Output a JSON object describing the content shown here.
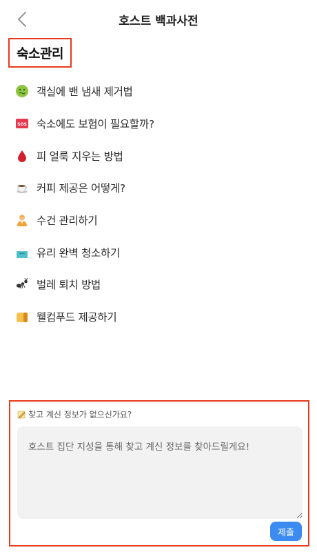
{
  "header": {
    "title": "호스트 백과사전",
    "back_icon": "chevron-left-icon"
  },
  "section": {
    "title": "숙소관리"
  },
  "topics": [
    {
      "label": "객실에 밴 냄새 제거법",
      "icon": "nauseated-face-icon"
    },
    {
      "label": "숙소에도 보험이 필요할까?",
      "icon": "sos-icon"
    },
    {
      "label": "피 얼룩 지우는 방법",
      "icon": "blood-drop-icon"
    },
    {
      "label": "커피 제공은 어떻게?",
      "icon": "coffee-icon"
    },
    {
      "label": "수건 관리하기",
      "icon": "person-icon"
    },
    {
      "label": "유리 완벽 청소하기",
      "icon": "tissue-box-icon"
    },
    {
      "label": "벌레 퇴치 방법",
      "icon": "ant-icon"
    },
    {
      "label": "웰컴푸드 제공하기",
      "icon": "bread-icon"
    }
  ],
  "request": {
    "label": "찾고 계신 정보가 없으신가요?",
    "icon": "memo-icon",
    "placeholder": "호스트 집단 지성을 통해 찾고 계신 정보를 찾아드릴게요!",
    "value": "",
    "submit_label": "제출"
  },
  "colors": {
    "highlight_border": "#e8391a",
    "submit_button": "#3b8bf0",
    "textarea_bg": "#f2f2f2"
  }
}
